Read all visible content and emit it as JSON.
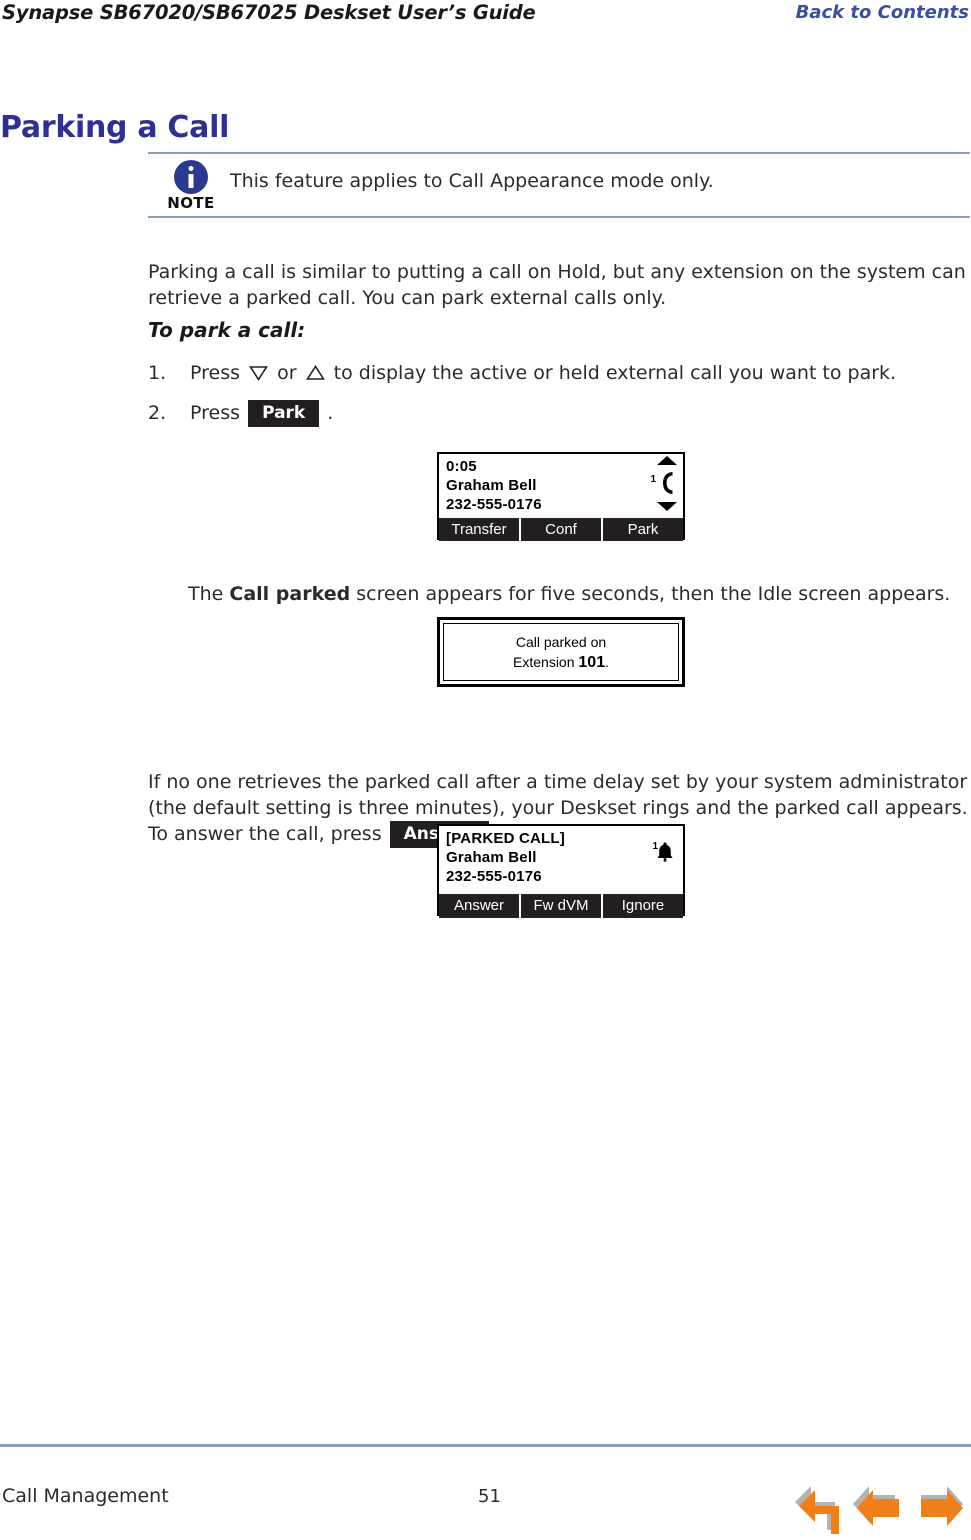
{
  "header": {
    "title": "Synapse SB67020/SB67025 Deskset User’s Guide",
    "back_to_contents": "Back to Contents",
    "link_color": "#3b4fa0"
  },
  "page": {
    "title": "Parking a Call",
    "title_color": "#2e3192"
  },
  "note": {
    "label": "NOTE",
    "icon": "info-icon",
    "text": "This feature applies to Call Appearance mode only."
  },
  "body": {
    "intro": "Parking a call is similar to putting a call on Hold, but any extension on the system can retrieve a parked call. You can park external calls only.",
    "subhead": "To park a call:",
    "steps": [
      {
        "number": "1.",
        "text_before": "Press",
        "icon_down": "triangle-down-icon",
        "conjunction": "or",
        "icon_up": "triangle-up-icon",
        "text_after": "to display the active or held external call you want to park."
      },
      {
        "number": "2.",
        "text_before": "Press",
        "key": "Park",
        "text_after": "."
      }
    ],
    "call_parked_caption_before": "The ",
    "call_parked_caption_bold": "Call parked",
    "call_parked_caption_after": " screen appears for five seconds, then the Idle screen appears.",
    "no_retrieve_part1": "If no one retrieves the parked call after a time delay set by your system administrator (the default setting is three minutes), your Deskset rings and the parked call appears. To answer the call, press ",
    "no_retrieve_key": "Answer",
    "no_retrieve_part2": "."
  },
  "lcd_active": {
    "line1": "0:05",
    "line2": "Graham  Bell",
    "line3": "232-555-0176",
    "line_count": "1",
    "status_icons": [
      "scroll-up-icon",
      "handset-icon",
      "scroll-down-icon"
    ],
    "softkeys": [
      "Transfer",
      "Conf",
      "Park"
    ]
  },
  "call_parked_dialog": {
    "line1": "Call parked on",
    "line2_prefix": "Extension ",
    "line2_extension": "101",
    "line2_suffix": "."
  },
  "lcd_parked": {
    "line1": "[PARKED CALL]",
    "line2": "Graham  Bell",
    "line3": "232-555-0176",
    "line_count": "1",
    "status_icons": [
      "bell-icon"
    ],
    "softkeys": [
      "Answer",
      "Fw dVM",
      "Ignore"
    ]
  },
  "footer": {
    "section": "Call Management",
    "page_number": "51",
    "nav": [
      {
        "name": "back-arrow",
        "label": "Back"
      },
      {
        "name": "previous-arrow",
        "label": "Previous"
      },
      {
        "name": "next-arrow",
        "label": "Next"
      }
    ],
    "rule_color": "#8b9dc3",
    "arrow_color": "#F07F1A"
  }
}
